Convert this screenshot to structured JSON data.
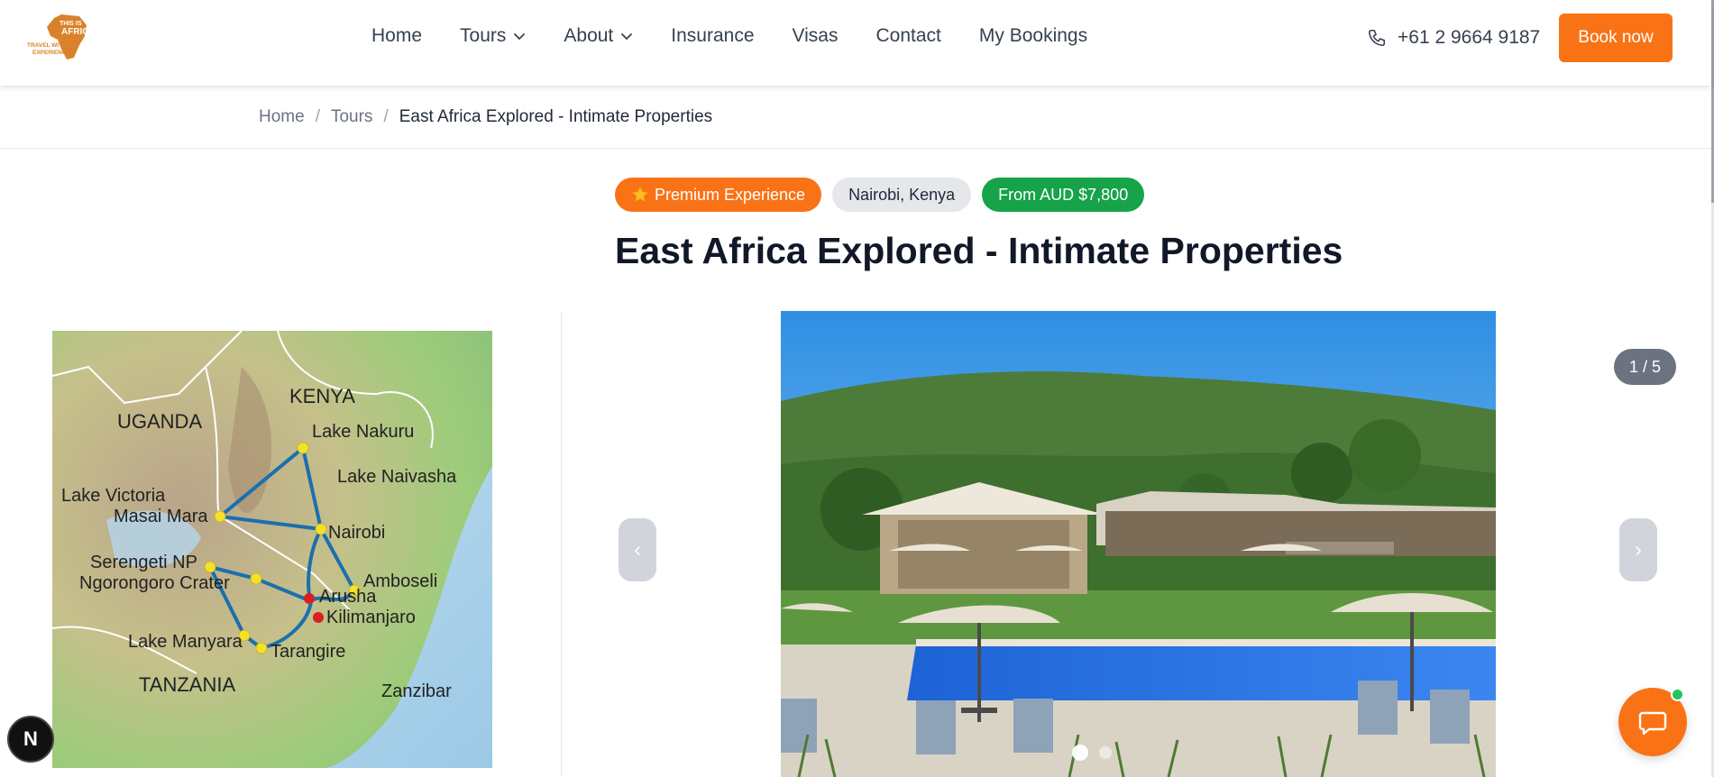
{
  "brand": {
    "logo_text": [
      "THIS IS",
      "AFRICA"
    ],
    "tagline": [
      "TRAVEL WITH",
      "EXPERIENCE"
    ]
  },
  "nav": {
    "items": [
      {
        "label": "Home",
        "dropdown": false
      },
      {
        "label": "Tours",
        "dropdown": true
      },
      {
        "label": "About",
        "dropdown": true
      },
      {
        "label": "Insurance",
        "dropdown": false
      },
      {
        "label": "Visas",
        "dropdown": false
      },
      {
        "label": "Contact",
        "dropdown": false
      },
      {
        "label": "My Bookings",
        "dropdown": false
      }
    ],
    "phone": "+61 2 9664 9187",
    "book_label": "Book now"
  },
  "breadcrumb": {
    "items": [
      "Home",
      "Tours"
    ],
    "separator": "/",
    "current": "East Africa Explored - Intimate Properties"
  },
  "badges": {
    "premium": "Premium Experience",
    "location": "Nairobi, Kenya",
    "price": "From AUD $7,800"
  },
  "page_title": "East Africa Explored - Intimate Properties",
  "map": {
    "labels": {
      "kenya": "KENYA",
      "uganda": "UGANDA",
      "tanzania": "TANZANIA",
      "lake_nakuru": "Lake Nakuru",
      "lake_naivasha": "Lake Naivasha",
      "lake_victoria": "Lake Victoria",
      "masai_mara": "Masai Mara",
      "nairobi": "Nairobi",
      "serengeti": "Serengeti NP",
      "ngorongoro": "Ngorongoro Crater",
      "amboseli": "Amboseli",
      "arusha": "Arusha",
      "kilimanjaro": "Kilimanjaro",
      "lake_manyara": "Lake Manyara",
      "tarangire": "Tarangire",
      "zanzibar": "Zanzibar"
    }
  },
  "gallery": {
    "counter": "1 / 5",
    "prev": "‹",
    "next": "›"
  },
  "widgets": {
    "n_badge": "N"
  },
  "colors": {
    "accent": "#f97316",
    "price_badge": "#16a34a",
    "route": "#1b6fae",
    "stop_yellow": "#f5e12c",
    "stop_red": "#d81f26"
  }
}
